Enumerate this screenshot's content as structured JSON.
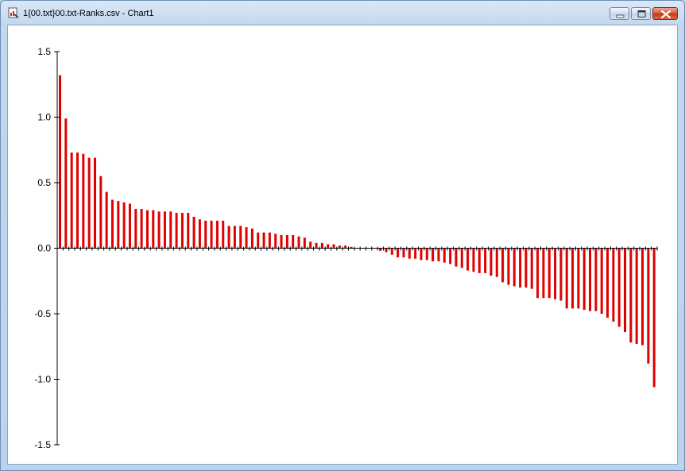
{
  "window": {
    "title": "1{00.txt}00.txt-Ranks.csv - Chart1",
    "minimize_label": "",
    "maximize_label": "",
    "close_label": ""
  },
  "colors": {
    "bar": "#e00000",
    "axis": "#000000",
    "background": "#ffffff"
  },
  "chart_data": {
    "type": "bar",
    "title": "",
    "xlabel": "",
    "ylabel": "",
    "ylim": [
      -1.5,
      1.5
    ],
    "yticks": [
      1.5,
      1.0,
      0.5,
      0.0,
      -0.5,
      -1.0,
      -1.5
    ],
    "ytick_labels": [
      "1.5",
      "1.0",
      "0.5",
      "0.0",
      "-0.5",
      "-1.0",
      "-1.5"
    ],
    "grid": false,
    "legend": "none",
    "values": [
      1.32,
      0.99,
      0.73,
      0.73,
      0.72,
      0.69,
      0.69,
      0.55,
      0.43,
      0.37,
      0.36,
      0.35,
      0.34,
      0.3,
      0.3,
      0.29,
      0.29,
      0.28,
      0.28,
      0.28,
      0.27,
      0.27,
      0.27,
      0.24,
      0.22,
      0.21,
      0.21,
      0.21,
      0.21,
      0.17,
      0.17,
      0.17,
      0.16,
      0.15,
      0.12,
      0.12,
      0.12,
      0.11,
      0.1,
      0.1,
      0.1,
      0.09,
      0.08,
      0.05,
      0.04,
      0.04,
      0.03,
      0.03,
      0.02,
      0.02,
      0.01,
      0.0,
      0.0,
      0.0,
      0.0,
      -0.02,
      -0.03,
      -0.05,
      -0.07,
      -0.07,
      -0.08,
      -0.08,
      -0.09,
      -0.09,
      -0.1,
      -0.1,
      -0.11,
      -0.12,
      -0.14,
      -0.15,
      -0.17,
      -0.18,
      -0.19,
      -0.19,
      -0.21,
      -0.22,
      -0.26,
      -0.28,
      -0.29,
      -0.3,
      -0.3,
      -0.31,
      -0.38,
      -0.38,
      -0.38,
      -0.39,
      -0.4,
      -0.46,
      -0.46,
      -0.46,
      -0.47,
      -0.48,
      -0.48,
      -0.5,
      -0.53,
      -0.56,
      -0.6,
      -0.64,
      -0.72,
      -0.73,
      -0.74,
      -0.88,
      -1.06
    ]
  }
}
